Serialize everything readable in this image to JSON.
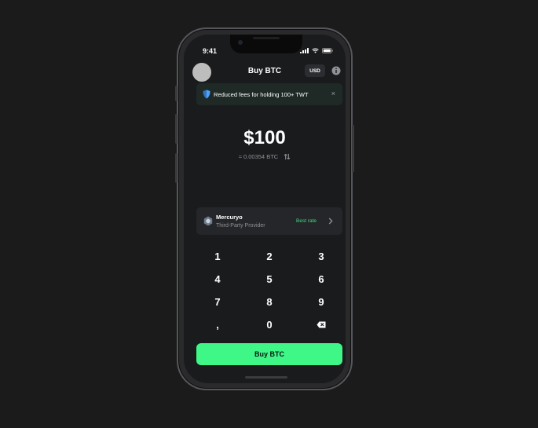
{
  "status_bar": {
    "time": "9:41"
  },
  "header": {
    "title": "Buy BTC",
    "currency": "USD"
  },
  "banner": {
    "text": "Reduced fees for holding 100+ TWT",
    "close": "×"
  },
  "amount": {
    "fiat": "$100",
    "crypto": "≈ 0.00354 BTC"
  },
  "provider": {
    "name": "Mercuryo",
    "type": "Third-Party Provider",
    "badge": "Best rate"
  },
  "keypad": {
    "keys": [
      "1",
      "2",
      "3",
      "4",
      "5",
      "6",
      "7",
      "8",
      "9",
      ",",
      "0"
    ]
  },
  "buy_button": {
    "label": "Buy BTC"
  },
  "colors": {
    "accent": "#3ef787",
    "best_rate": "#3ddc84",
    "background": "#1a1b1d",
    "banner": "#1f2a27"
  }
}
